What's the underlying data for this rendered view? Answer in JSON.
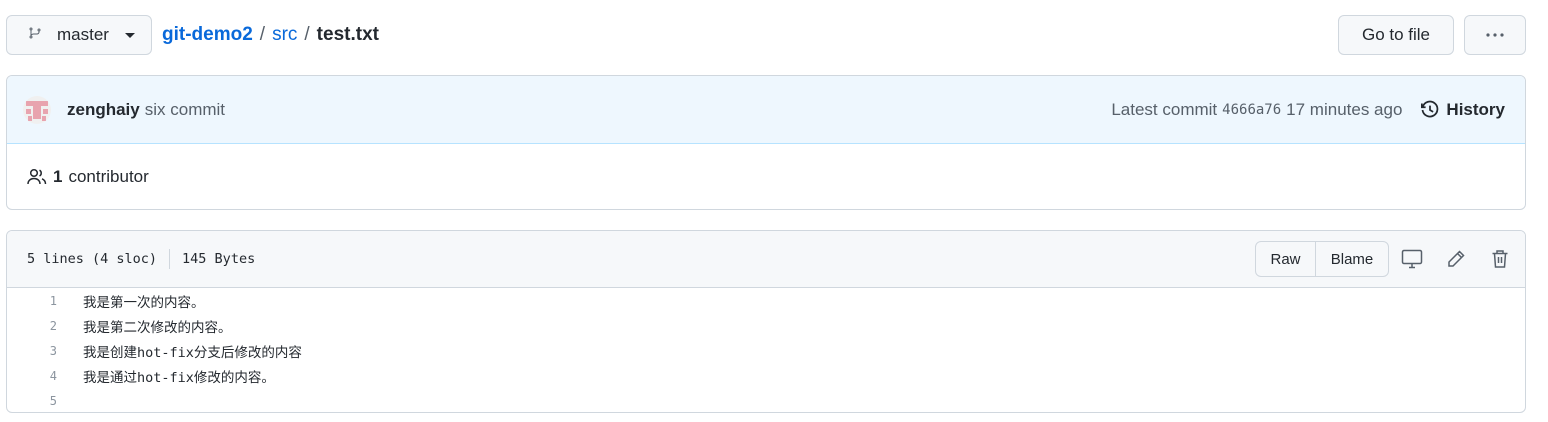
{
  "branch": {
    "name": "master"
  },
  "breadcrumb": {
    "repo": "git-demo2",
    "dir": "src",
    "file": "test.txt",
    "separator": "/"
  },
  "actions": {
    "goto_file": "Go to file",
    "more": "···"
  },
  "commit": {
    "author": "zenghaiy",
    "message": "six commit",
    "latest_label": "Latest commit",
    "sha": "4666a76",
    "time": "17 minutes ago",
    "history_label": "History"
  },
  "contributors": {
    "count": "1",
    "label": "contributor"
  },
  "file": {
    "lines_info": "5 lines (4 sloc)",
    "size": "145 Bytes",
    "raw_label": "Raw",
    "blame_label": "Blame",
    "lines": [
      {
        "num": "1",
        "text": "我是第一次的内容。"
      },
      {
        "num": "2",
        "text": "我是第二次修改的内容。"
      },
      {
        "num": "3",
        "text": "我是创建hot-fix分支后修改的内容"
      },
      {
        "num": "4",
        "text": "我是通过hot-fix修改的内容。"
      },
      {
        "num": "5",
        "text": ""
      }
    ]
  },
  "icons": {
    "branch": "git-branch-icon",
    "history": "history-clock-icon",
    "people": "people-icon",
    "desktop": "desktop-icon",
    "edit": "pencil-icon",
    "delete": "trash-icon"
  },
  "colors": {
    "link": "#0969da",
    "commit_bg": "#eef7fe",
    "border": "#d0d7de"
  }
}
